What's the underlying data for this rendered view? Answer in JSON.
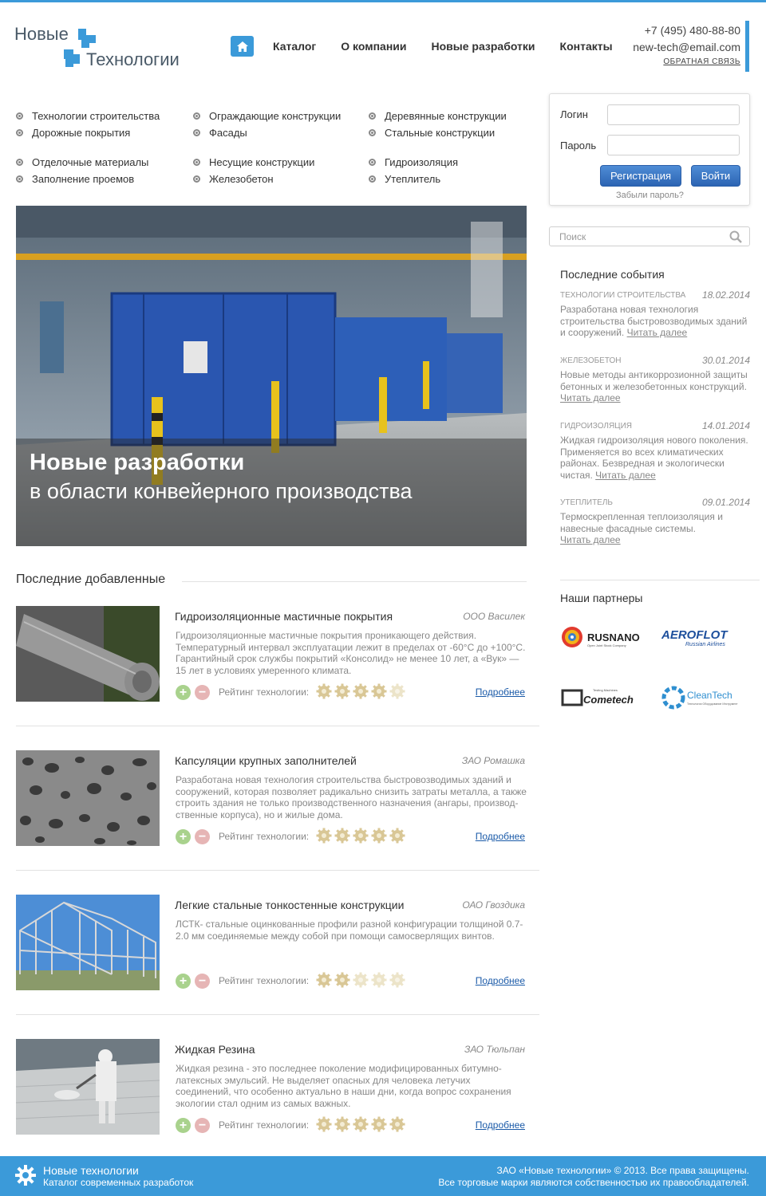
{
  "brand": {
    "line1": "Новые",
    "line2": "Технологии",
    "accent": "#3b9ad9"
  },
  "nav": {
    "home_icon": "home-icon",
    "items": [
      "Каталог",
      "О компании",
      "Новые разработки",
      "Контакты"
    ]
  },
  "contacts": {
    "phone": "+7 (495) 480-88-80",
    "email": "new-tech@email.com",
    "feedback": "ОБРАТНАЯ СВЯЗЬ"
  },
  "categories": [
    [
      "Технологии строительства",
      "Ограждающие конструкции",
      "Деревянные конструкции"
    ],
    [
      "Дорожные покрытия",
      "Фасады",
      "Стальные конструкции"
    ],
    [
      "Отделочные материалы",
      "Несущие конструкции",
      "Гидроизоляция"
    ],
    [
      "Заполнение проемов",
      "Железобетон",
      "Утеплитель"
    ]
  ],
  "hero": {
    "title": "Новые разработки",
    "subtitle": "в области конвейерного производства"
  },
  "login": {
    "login_label": "Логин",
    "password_label": "Пароль",
    "register": "Регистрация",
    "enter": "Войти",
    "forgot": "Забыли пароль?"
  },
  "search": {
    "placeholder": "Поиск"
  },
  "events": {
    "title": "Последние события",
    "items": [
      {
        "category": "Технологии строительства",
        "date": "18.02.2014",
        "text": "Разработана новая технология строительства быстровозводимых зданий и сооружений.",
        "link": "Читать далее"
      },
      {
        "category": "Железобетон",
        "date": "30.01.2014",
        "text": "Новые методы антикоррозионной защиты бетонных и железобетонных конструкций.",
        "link": "Читать далее"
      },
      {
        "category": "Гидроизоляция",
        "date": "14.01.2014",
        "text": "Жидкая гидроизоляция нового поколения. Применяется во всех климатических районах. Безвредная и экологически чистая.",
        "link": "Читать далее"
      },
      {
        "category": "Утеплитель",
        "date": "09.01.2014",
        "text": "Термоскрепленная теплоизоляция и навесные фасадные системы.",
        "link": "Читать далее"
      }
    ]
  },
  "partners": {
    "title": "Наши партнеры",
    "items": [
      {
        "name": "RUSNANO",
        "sub": "Open Joint Stock Company"
      },
      {
        "name": "AEROFLOT",
        "sub": "Russian Airlines"
      },
      {
        "name": "Cometech",
        "sub": "Testing Machines"
      },
      {
        "name": "CleanTech",
        "sub": "Технологии Оборудование Инструмент"
      }
    ]
  },
  "recent": {
    "title": "Последние добавленные",
    "rating_label": "Рейтинг технологии:",
    "more_label": "Подробнее",
    "items": [
      {
        "name": "Гидроизоляционные мастичные покрытия",
        "company": "ООО Василек",
        "desc": "Гидроизоляционные мастичные покрытия проникающего действия. Температурный интервал эксплуатации лежит в пределах от -60°C до +100°C. Гарантийный срок службы покрытий «Консолид» не менее 10 лет, а «Вук» — 15 лет в условиях умеренного климата.",
        "rating": 4
      },
      {
        "name": "Капсуляции крупных заполнителей",
        "company": "ЗАО Ромашка",
        "desc": "Разработана новая технология строительства быстровозводимых зданий и сооружений, которая позволяет радикально снизить затраты металла, а также строить здания не только производственного назначения (ангары, производ- ственные корпуса), но и жилые дома.",
        "rating": 5
      },
      {
        "name": "Легкие стальные тонкостенные конструкции",
        "company": "ОАО Гвоздика",
        "desc": "ЛСТК- стальные оцинкованные профили разной конфигурации толщиной 0.7-2.0 мм соединяемые между собой при помощи самосверлящих винтов.",
        "rating": 2
      },
      {
        "name": "Жидкая Резина",
        "company": "ЗАО Тюльпан",
        "desc": "Жидкая резина - это последнее поколение модифицированных битумно-латексных эмульсий. Не выделяет опасных для человека летучих соединений, что особенно актуально в наши дни, когда вопрос сохранения экологии стал одним из самых важных.",
        "rating": 5
      }
    ]
  },
  "footer": {
    "title": "Новые технологии",
    "subtitle": "Каталог современных разработок",
    "copyright": "ЗАО «Новые технологии» © 2013. Все права защищены.",
    "trademarks": "Все торговые марки являются собственностью их правообладателей."
  }
}
